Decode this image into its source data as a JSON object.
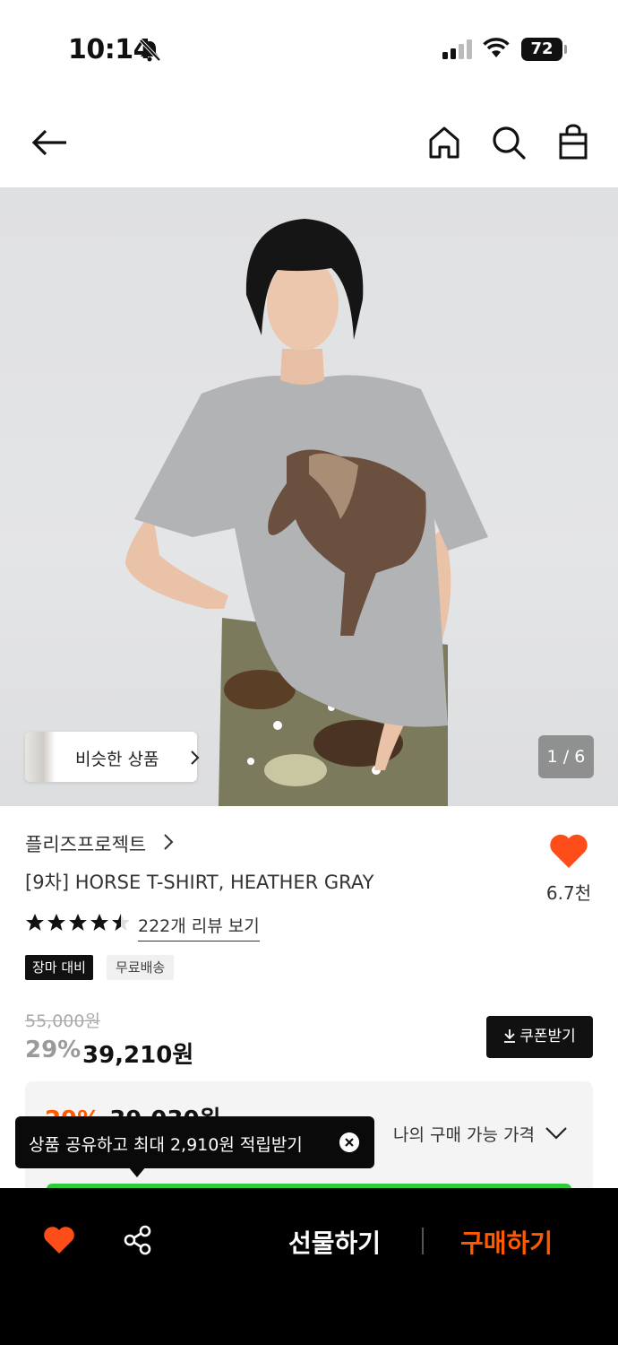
{
  "status_bar": {
    "time": "10:14",
    "battery": "72"
  },
  "gallery": {
    "similar_label": "비슷한 상품",
    "pager": "1 / 6"
  },
  "product": {
    "brand": "플리즈프로젝트",
    "title": "[9차] HORSE T-SHIRT, HEATHER GRAY",
    "like_count": "6.7천",
    "rating": 4.5,
    "reviews_link": "222개 리뷰 보기",
    "tags": [
      "장마 대비",
      "무료배송"
    ],
    "original_price": "55,000원",
    "discount_rate": "29%",
    "sale_price": "39,210원",
    "coupon_label": "쿠폰받기"
  },
  "price_box": {
    "best_discount": "29%",
    "best_price": "39,030원",
    "available_price_label": "나의 구매 가능 가격"
  },
  "tooltip": {
    "text": "상품 공유하고 최대 2,910원 적립받기"
  },
  "bottom_bar": {
    "gift_label": "선물하기",
    "buy_label": "구매하기"
  },
  "colors": {
    "accent": "#ff5a00",
    "heart": "#ff4d1a",
    "promo_green": "#2fcc3a"
  }
}
